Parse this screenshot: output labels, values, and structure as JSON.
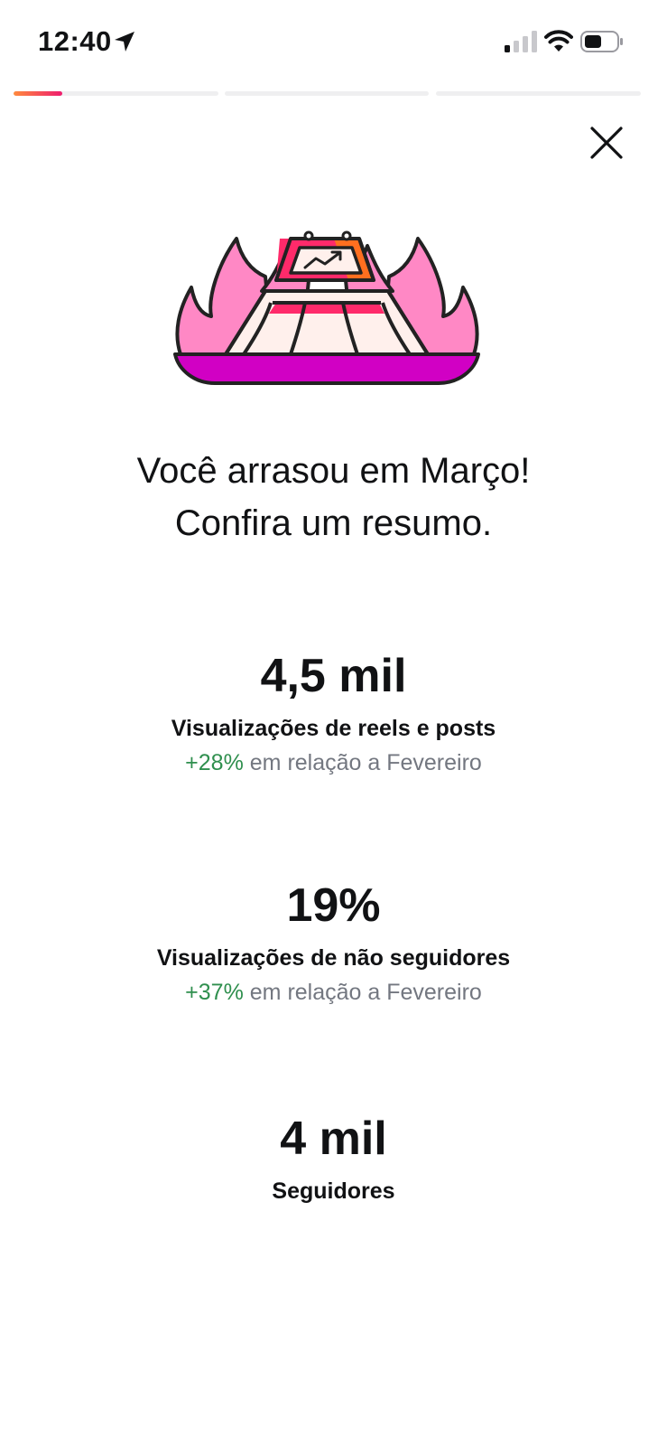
{
  "status_bar": {
    "time": "12:40",
    "icons": [
      "location-arrow-icon",
      "cellular-signal-icon",
      "wifi-icon",
      "battery-icon"
    ]
  },
  "story": {
    "segments": 3,
    "active_segment": 1,
    "active_progress": 0.24,
    "progress_color_start": "#ff8a3d",
    "progress_color_end": "#ee1d6e"
  },
  "close_icon": "close-icon",
  "illustration_icon": "fiery-trophy-chart-illustration",
  "headline": {
    "line1": "Você arrasou em Março!",
    "line2": "Confira um resumo."
  },
  "stats": {
    "views": {
      "value": "4,5 mil",
      "label": "Visualizações de reels e posts",
      "change": "+28%",
      "comparison": "em relação a Fevereiro"
    },
    "nonfollowers": {
      "value": "19%",
      "label": "Visualizações de não seguidores",
      "change": "+37%",
      "comparison": "em relação a Fevereiro"
    },
    "followers": {
      "value": "4 mil",
      "label": "Seguidores"
    }
  },
  "colors": {
    "positive_change": "#2f8f4e",
    "secondary_text": "#737780",
    "flame_pink": "#ff88c5",
    "base_magenta": "#d100c4"
  }
}
